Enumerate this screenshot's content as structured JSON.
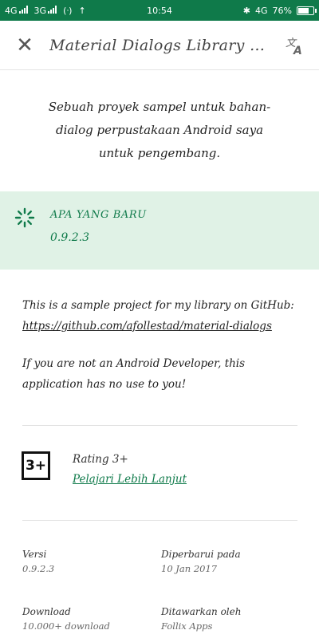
{
  "status_bar": {
    "sim1": "4G",
    "sim2": "3G",
    "wifi_label": "(ᐧ)",
    "upload_glyph": "↑",
    "time": "10:54",
    "bluetooth_glyph": "✱",
    "network": "4G",
    "battery": "76%",
    "battery_level": 0.76
  },
  "toolbar": {
    "close_glyph": "✕",
    "title": "Material Dialogs Library D...",
    "translate_icon": "translate-icon"
  },
  "description": "Sebuah proyek sampel untuk bahan-dialog perpustakaan Android saya untuk pengembang.",
  "whats_new": {
    "label": "APA YANG BARU",
    "version": "0.9.2.3",
    "icon": "loading-spinner-icon",
    "accent_color": "#0f7a4a"
  },
  "body": {
    "p1_line1": "This is a sample project for my library on GitHub:",
    "p1_link": "https://github.com/afollestad/material-dialogs",
    "p2": "If you are not an Android Developer, this application has no use to you!"
  },
  "rating": {
    "badge": "3+",
    "label": "Rating 3+",
    "link": "Pelajari Lebih Lanjut"
  },
  "info": {
    "version_label": "Versi",
    "version_value": "0.9.2.3",
    "updated_label": "Diperbarui pada",
    "updated_value": "10 Jan 2017",
    "downloads_label": "Download",
    "downloads_value": "10.000+ download",
    "offered_label": "Ditawarkan oleh",
    "offered_value": "Follix Apps"
  }
}
